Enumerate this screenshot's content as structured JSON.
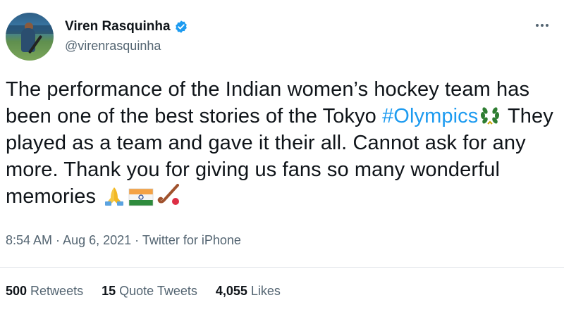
{
  "author": {
    "display_name": "Viren Rasquinha",
    "handle": "@virenrasquinha",
    "verified": true
  },
  "tweet": {
    "text_part1": "The performance of the Indian women’s hockey team has been one of the best stories of the Tokyo ",
    "hashtag": "#Olympics",
    "text_part2": " They played as a team and gave it their all. Cannot ask for any more. Thank you for giving us fans so many wonderful memories "
  },
  "meta": {
    "time": "8:54 AM",
    "separator1": " · ",
    "date": "Aug 6, 2021",
    "separator2": " · ",
    "source": "Twitter for iPhone"
  },
  "stats": {
    "retweets_count": "500",
    "retweets_label": "Retweets",
    "quotes_count": "15",
    "quotes_label": "Quote Tweets",
    "likes_count": "4,055",
    "likes_label": "Likes"
  },
  "icons": [
    "verified-badge-icon",
    "more-options-icon",
    "laurel-wreath-icon",
    "folded-hands-icon",
    "india-flag-icon",
    "field-hockey-icon"
  ],
  "colors": {
    "accent": "#1d9bf0",
    "text": "#0f1419",
    "secondary": "#536471"
  }
}
